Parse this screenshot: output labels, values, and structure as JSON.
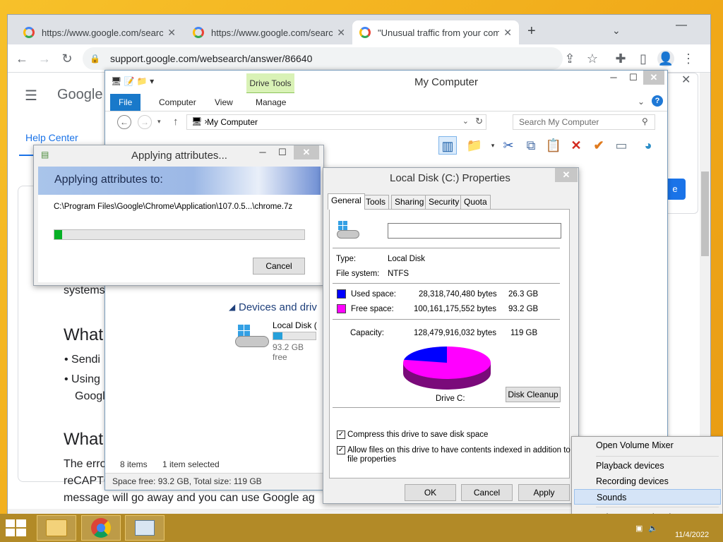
{
  "browser": {
    "tabs": [
      {
        "title": "https://www.google.com/search?"
      },
      {
        "title": "https://www.google.com/search?"
      },
      {
        "title": "\"Unusual traffic from your compu"
      }
    ],
    "url": "support.google.com/websearch/answer/86640"
  },
  "google_page": {
    "logo": "Google",
    "help_center": "Help Center",
    "frag_systems": "systems",
    "heading1": "What",
    "bullet1": "Sendi",
    "bullet2": "Using",
    "bullet2b": "Googl",
    "heading2": "What",
    "para1": "The erro",
    "para2": "reCAPTC",
    "para3": "message will go away and you can use Google ag",
    "button_frag": "e"
  },
  "explorer": {
    "title": "My Computer",
    "drive_tools": "Drive Tools",
    "ribbon_tabs": [
      "File",
      "Computer",
      "View",
      "Manage"
    ],
    "address": "My Computer",
    "search_placeholder": "Search My Computer",
    "devices_header": "Devices and driv",
    "local_disk_label": "Local Disk (",
    "local_disk_free": "93.2 GB free",
    "items_count": "8 items",
    "selected_count": "1 item selected",
    "status_bar": "Space free: 93.2 GB, Total size: 119 GB",
    "drive_used_fraction": 0.22
  },
  "apply_dialog": {
    "title": "Applying attributes...",
    "heading": "Applying attributes to:",
    "path": "C:\\Program Files\\Google\\Chrome\\Application\\107.0.5...\\chrome.7z",
    "progress_fraction": 0.03,
    "cancel": "Cancel"
  },
  "properties": {
    "title": "Local Disk (C:) Properties",
    "tabs": [
      "General",
      "Tools",
      "Sharing",
      "Security",
      "Quota"
    ],
    "name_value": "",
    "type_label": "Type:",
    "type_value": "Local Disk",
    "fs_label": "File system:",
    "fs_value": "NTFS",
    "used_label": "Used space:",
    "used_bytes": "28,318,740,480 bytes",
    "used_gb": "26.3 GB",
    "free_label": "Free space:",
    "free_bytes": "100,161,175,552 bytes",
    "free_gb": "93.2 GB",
    "capacity_label": "Capacity:",
    "capacity_bytes": "128,479,916,032 bytes",
    "capacity_gb": "119 GB",
    "drive_label": "Drive C:",
    "disk_cleanup": "Disk Cleanup",
    "compress_label": "Compress this drive to save disk space",
    "index_label_1": "Allow files on this drive to have contents indexed in addition to",
    "index_label_2": "file properties",
    "ok": "OK",
    "cancel": "Cancel",
    "apply": "Apply",
    "colors": {
      "used": "#0000ff",
      "free": "#ff00ff"
    }
  },
  "volume_menu": {
    "items": [
      "Open Volume Mixer",
      "Playback devices",
      "Recording devices",
      "Sounds",
      "Volume control options"
    ]
  },
  "taskbar": {
    "date": "11/4/2022"
  }
}
